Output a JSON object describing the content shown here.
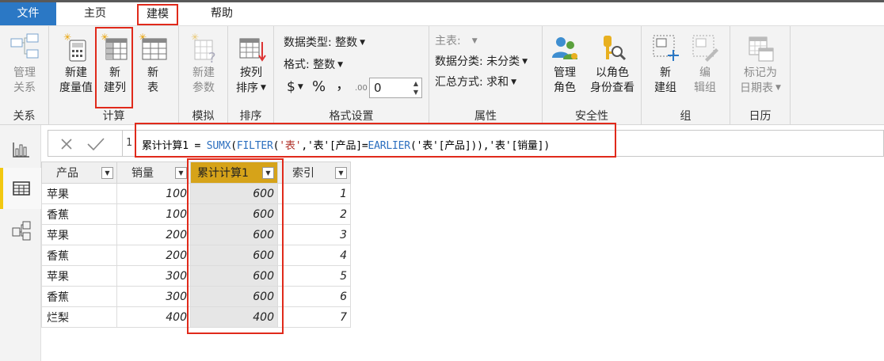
{
  "menu": {
    "file": "文件",
    "home": "主页",
    "model": "建模",
    "help": "帮助"
  },
  "ribbon": {
    "relations": {
      "button": [
        "管理",
        "关系"
      ],
      "group": "关系"
    },
    "calc": {
      "new_measure": [
        "新建",
        "度量值"
      ],
      "new_column": [
        "新",
        "建列"
      ],
      "new_table": [
        "新",
        "表"
      ],
      "group": "计算"
    },
    "whatif": {
      "button": [
        "新建",
        "参数"
      ],
      "group": "模拟"
    },
    "sort": {
      "button": [
        "按列",
        "排序"
      ],
      "group": "排序"
    },
    "format": {
      "data_type": "数据类型: 整数",
      "format": "格式: 整数",
      "currency": "$",
      "percent": "%",
      "comma": "，",
      "decimal_icon": ".00",
      "decimal_value": "0",
      "group": "格式设置"
    },
    "properties": {
      "home_table": "主表:",
      "data_category": "数据分类: 未分类",
      "summarize": "汇总方式: 求和",
      "group": "属性"
    },
    "security": {
      "manage_roles": [
        "管理",
        "角色"
      ],
      "view_as": [
        "以角色",
        "身份查看"
      ],
      "group": "安全性"
    },
    "groups": {
      "new_group": [
        "新",
        "建组"
      ],
      "edit_group": [
        "编",
        "辑组"
      ],
      "group": "组"
    },
    "calendar": {
      "button": [
        "标记为",
        "日期表"
      ],
      "group": "日历"
    }
  },
  "formula": {
    "line_number": "1",
    "parts": [
      {
        "t": "累计计算1 = ",
        "c": ""
      },
      {
        "t": "SUMX",
        "c": "fn"
      },
      {
        "t": "(",
        "c": ""
      },
      {
        "t": "FILTER",
        "c": "fn"
      },
      {
        "t": "(",
        "c": ""
      },
      {
        "t": "'表'",
        "c": "str"
      },
      {
        "t": ",",
        "c": ""
      },
      {
        "t": "'表'[产品]",
        "c": ""
      },
      {
        "t": "=",
        "c": ""
      },
      {
        "t": "EARLIER",
        "c": "fn"
      },
      {
        "t": "(",
        "c": ""
      },
      {
        "t": "'表'[产品]",
        "c": ""
      },
      {
        "t": ")),",
        "c": ""
      },
      {
        "t": "'表'[销量]",
        "c": ""
      },
      {
        "t": ")",
        "c": ""
      }
    ]
  },
  "table": {
    "columns": [
      "产品",
      "销量",
      "累计计算1",
      "索引"
    ],
    "rows": [
      [
        "苹果",
        "100",
        "600",
        "1"
      ],
      [
        "香蕉",
        "100",
        "600",
        "2"
      ],
      [
        "苹果",
        "200",
        "600",
        "3"
      ],
      [
        "香蕉",
        "200",
        "600",
        "4"
      ],
      [
        "苹果",
        "300",
        "600",
        "5"
      ],
      [
        "香蕉",
        "300",
        "600",
        "6"
      ],
      [
        "烂梨",
        "400",
        "400",
        "7"
      ]
    ]
  },
  "colors": {
    "accent_file_tab": "#2b78c5",
    "highlight_red": "#e02a1b",
    "column_header_active": "#d6a319",
    "rail_active": "#f2c811",
    "dax_function": "#2c6fbf"
  }
}
